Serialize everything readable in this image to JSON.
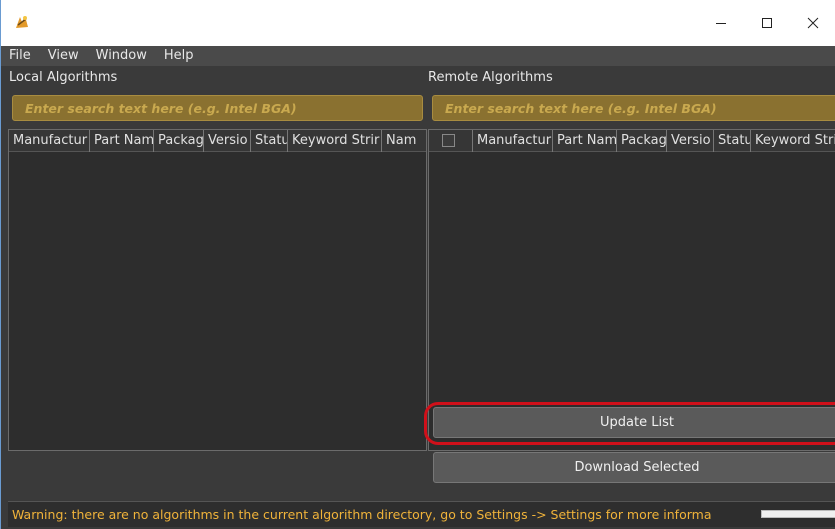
{
  "window": {
    "minimize_icon": "minimize-icon",
    "maximize_icon": "maximize-icon",
    "close_icon": "close-icon"
  },
  "menu": {
    "items": [
      {
        "label": "File"
      },
      {
        "label": "View"
      },
      {
        "label": "Window"
      },
      {
        "label": "Help"
      }
    ]
  },
  "local": {
    "label": "Local Algorithms",
    "search_placeholder": "Enter search text here (e.g. Intel BGA)",
    "columns": [
      {
        "label": "Manufactur"
      },
      {
        "label": "Part Nam"
      },
      {
        "label": "Packag"
      },
      {
        "label": "Versio"
      },
      {
        "label": "Statu"
      },
      {
        "label": "Keyword Strir"
      },
      {
        "label": "Nam"
      }
    ],
    "rows": []
  },
  "remote": {
    "label": "Remote Algorithms",
    "search_placeholder": "Enter search text here (e.g. Intel BGA)",
    "columns": [
      {
        "label": "Manufactur"
      },
      {
        "label": "Part Nam"
      },
      {
        "label": "Packag"
      },
      {
        "label": "Versio"
      },
      {
        "label": "Statu"
      },
      {
        "label": "Keyword Stri"
      }
    ],
    "rows": []
  },
  "buttons": {
    "update": "Update List",
    "download": "Download Selected"
  },
  "status": {
    "text": "Warning: there are no algorithms in the current algorithm directory, go to Settings -> Settings for more informa",
    "progress": 0
  },
  "colors": {
    "background": "#3a3a3a",
    "search_bg": "#8a7130",
    "warning_text": "#f0b33a",
    "highlight": "#d0101a"
  }
}
